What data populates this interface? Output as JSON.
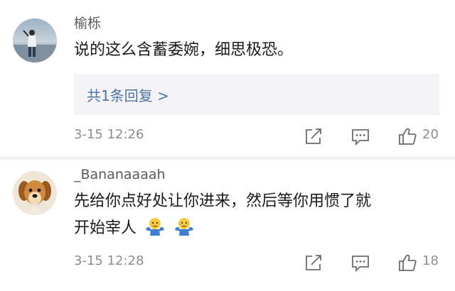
{
  "comments": [
    {
      "username": "榆栎",
      "text": "说的这么含蓄委婉，细思极恐。",
      "reply_summary": "共1条回复 >",
      "time": "3-15 12:26",
      "likes": "20",
      "avatar_icon": "person-by-sea-avatar"
    },
    {
      "username": "_Bananaaaah",
      "text_line1": "先给你点好处让你进来，然后等你用惯了就",
      "text_line2": "开始宰人",
      "emoji_icon": "shrug-emoji-icon",
      "time": "3-15 12:28",
      "likes": "18",
      "avatar_icon": "dog-avatar"
    }
  ],
  "icons": {
    "share": "share-icon",
    "reply": "comment-icon",
    "like": "thumbs-up-icon"
  },
  "colors": {
    "link": "#4f73a6",
    "meta": "#8d8d8d",
    "reply_bg": "#f4f4f6"
  }
}
